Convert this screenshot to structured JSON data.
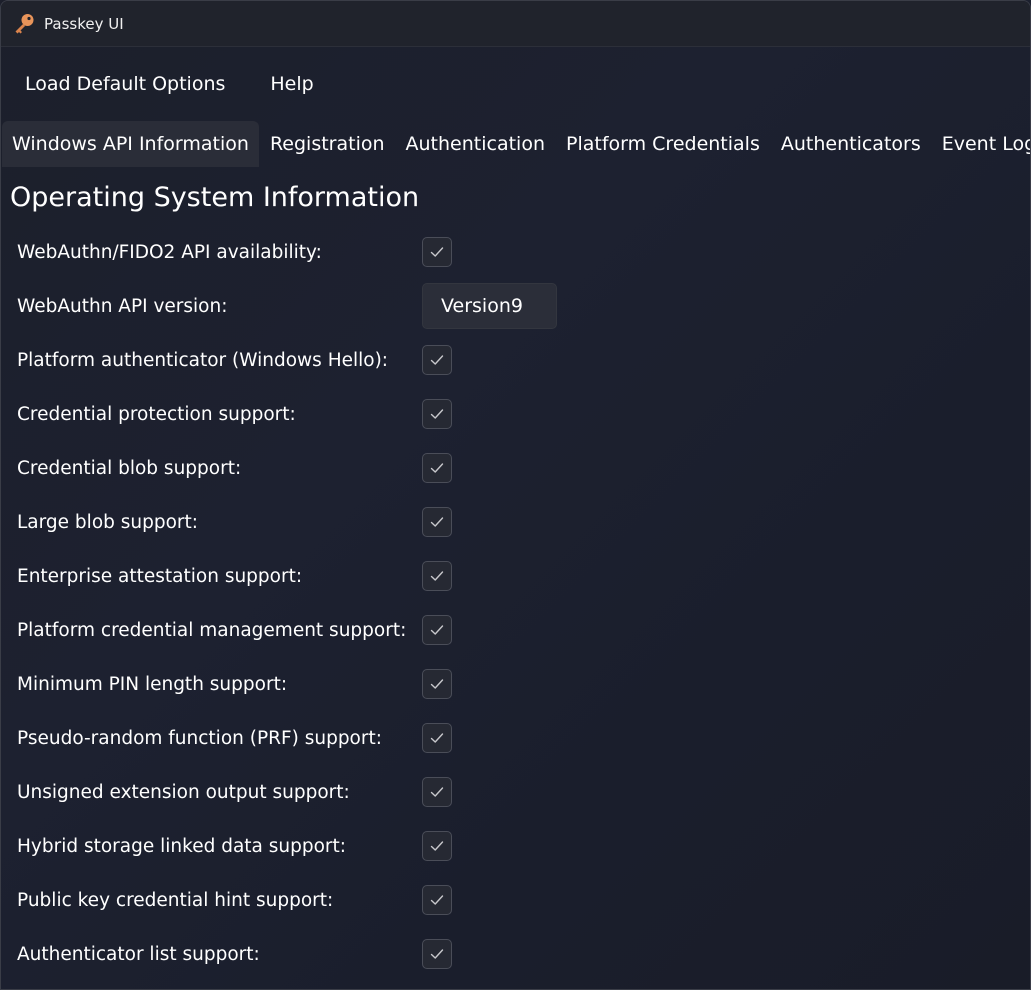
{
  "titlebar": {
    "title": "Passkey UI",
    "icon": "key-icon"
  },
  "menu": {
    "items": [
      "Load Default Options",
      "Help"
    ]
  },
  "tabs": [
    {
      "label": "Windows API Information",
      "selected": true
    },
    {
      "label": "Registration",
      "selected": false
    },
    {
      "label": "Authentication",
      "selected": false
    },
    {
      "label": "Platform Credentials",
      "selected": false
    },
    {
      "label": "Authenticators",
      "selected": false
    },
    {
      "label": "Event Log",
      "selected": false
    }
  ],
  "section": {
    "title": "Operating System Information"
  },
  "rows": [
    {
      "label": "WebAuthn/FIDO2 API availability:",
      "type": "checkbox",
      "checked": true
    },
    {
      "label": "WebAuthn API version:",
      "type": "text",
      "value": "Version9"
    },
    {
      "label": "Platform authenticator (Windows Hello):",
      "type": "checkbox",
      "checked": true
    },
    {
      "label": "Credential protection support:",
      "type": "checkbox",
      "checked": true
    },
    {
      "label": "Credential blob support:",
      "type": "checkbox",
      "checked": true
    },
    {
      "label": "Large blob support:",
      "type": "checkbox",
      "checked": true
    },
    {
      "label": "Enterprise attestation support:",
      "type": "checkbox",
      "checked": true
    },
    {
      "label": "Platform credential management support:",
      "type": "checkbox",
      "checked": true
    },
    {
      "label": "Minimum PIN length support:",
      "type": "checkbox",
      "checked": true
    },
    {
      "label": "Pseudo-random function (PRF) support:",
      "type": "checkbox",
      "checked": true
    },
    {
      "label": "Unsigned extension output support:",
      "type": "checkbox",
      "checked": true
    },
    {
      "label": "Hybrid storage linked data support:",
      "type": "checkbox",
      "checked": true
    },
    {
      "label": "Public key credential hint support:",
      "type": "checkbox",
      "checked": true
    },
    {
      "label": "Authenticator list support:",
      "type": "checkbox",
      "checked": true
    }
  ],
  "colors": {
    "background": "#1c1f2b",
    "titlebar": "#20232c",
    "selected_tab": "#2a2d38",
    "checkbox_border": "#4a4d58",
    "checkmark": "#c8c8cc"
  }
}
